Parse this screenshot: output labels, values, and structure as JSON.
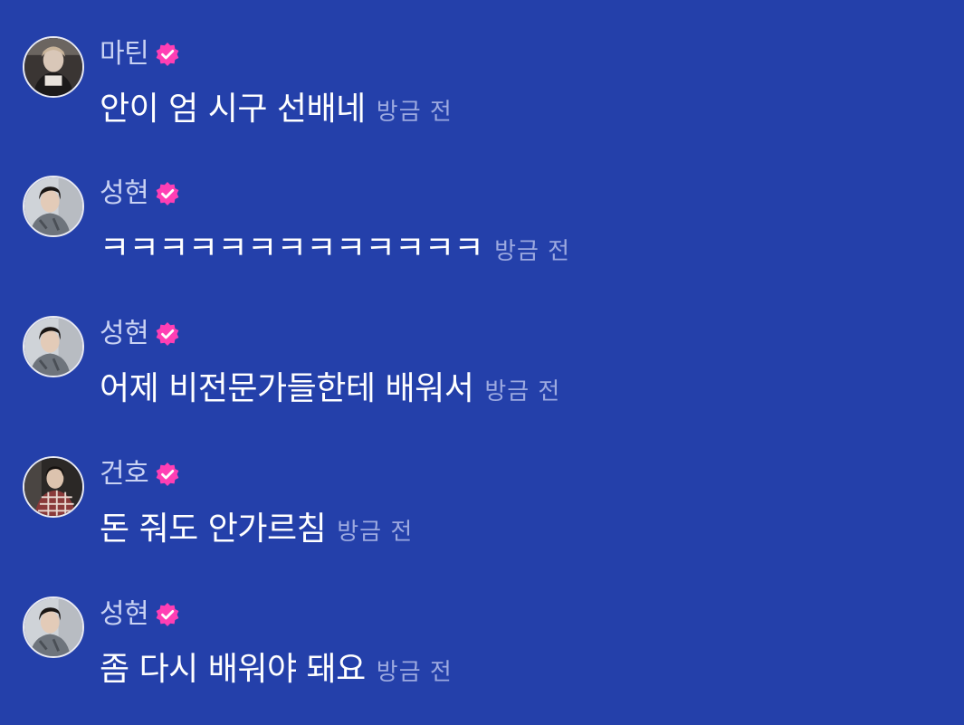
{
  "colors": {
    "background": "#2440aa",
    "username": "#c9d2f3",
    "message_text": "#ffffff",
    "timestamp": "#9ca9e0",
    "verified_badge": "#ff3fb4"
  },
  "messages": [
    {
      "username": "마틴",
      "verified": true,
      "text": "안이 엄 시구 선배네",
      "timestamp": "방금 전",
      "avatar_icon": "avatar-martin"
    },
    {
      "username": "성현",
      "verified": true,
      "text": "ㅋㅋㅋㅋㅋㅋㅋㅋㅋㅋㅋㅋㅋ",
      "timestamp": "방금 전",
      "avatar_icon": "avatar-seonghyeon"
    },
    {
      "username": "성현",
      "verified": true,
      "text": "어제 비전문가들한테 배워서",
      "timestamp": "방금 전",
      "avatar_icon": "avatar-seonghyeon"
    },
    {
      "username": "건호",
      "verified": true,
      "text": "돈 줘도 안가르침",
      "timestamp": "방금 전",
      "avatar_icon": "avatar-geonho"
    },
    {
      "username": "성현",
      "verified": true,
      "text": "좀 다시 배워야 돼요",
      "timestamp": "방금 전",
      "avatar_icon": "avatar-seonghyeon"
    }
  ]
}
